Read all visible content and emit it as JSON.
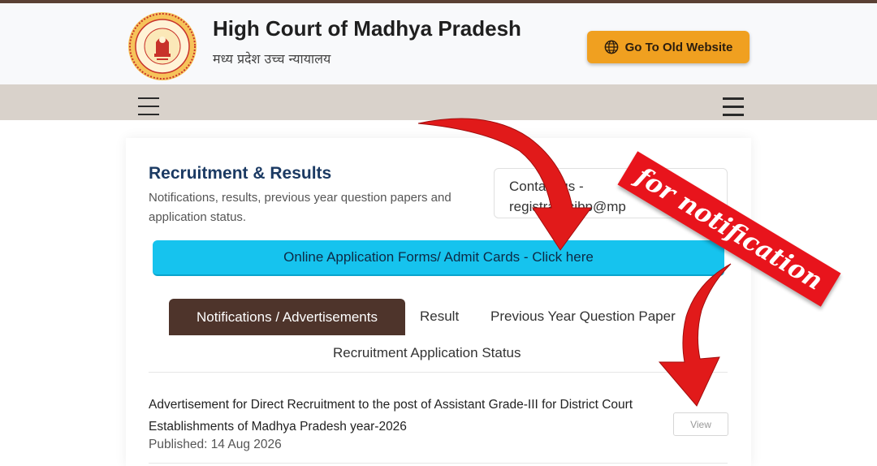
{
  "header": {
    "title": "High Court of Madhya Pradesh",
    "subtitle": "मध्य प्रदेश उच्च न्यायालय",
    "old_site_button": "Go To Old Website",
    "emblem_icon": "state-emblem-icon",
    "globe_icon": "globe-icon"
  },
  "navbar": {
    "left_icon": "menu-icon",
    "right_icon": "hamburger-icon"
  },
  "section": {
    "title": "Recruitment & Results",
    "description": "Notifications, results, previous year question papers and application status.",
    "contact_line1": "Contact us - ",
    "contact_line2": "registrarhcjbp@mp"
  },
  "online_button": "Online Application Forms/ Admit Cards - Click here",
  "tabs": [
    {
      "label": "Notifications / Advertisements",
      "active": true
    },
    {
      "label": "Result"
    },
    {
      "label": "Previous Year Question Paper"
    },
    {
      "label": "Recruitment Application Status"
    }
  ],
  "notice": {
    "title": "Advertisement for Direct Recruitment to the post of Assistant Grade-III for District Court Establishments of Madhya Pradesh year-2026",
    "published": "Published: 14 Aug 2026",
    "view_label": "View"
  },
  "overlay": {
    "banner_text": "for notification",
    "arrow_color": "#e11a1a",
    "banner_color": "#e8141c"
  },
  "colors": {
    "title_blue": "#1b3a63",
    "tab_active_bg": "#4e342b",
    "button_cyan": "#16c3ee",
    "old_site_orange": "#f0a020",
    "navbar": "#d9d2cb"
  }
}
